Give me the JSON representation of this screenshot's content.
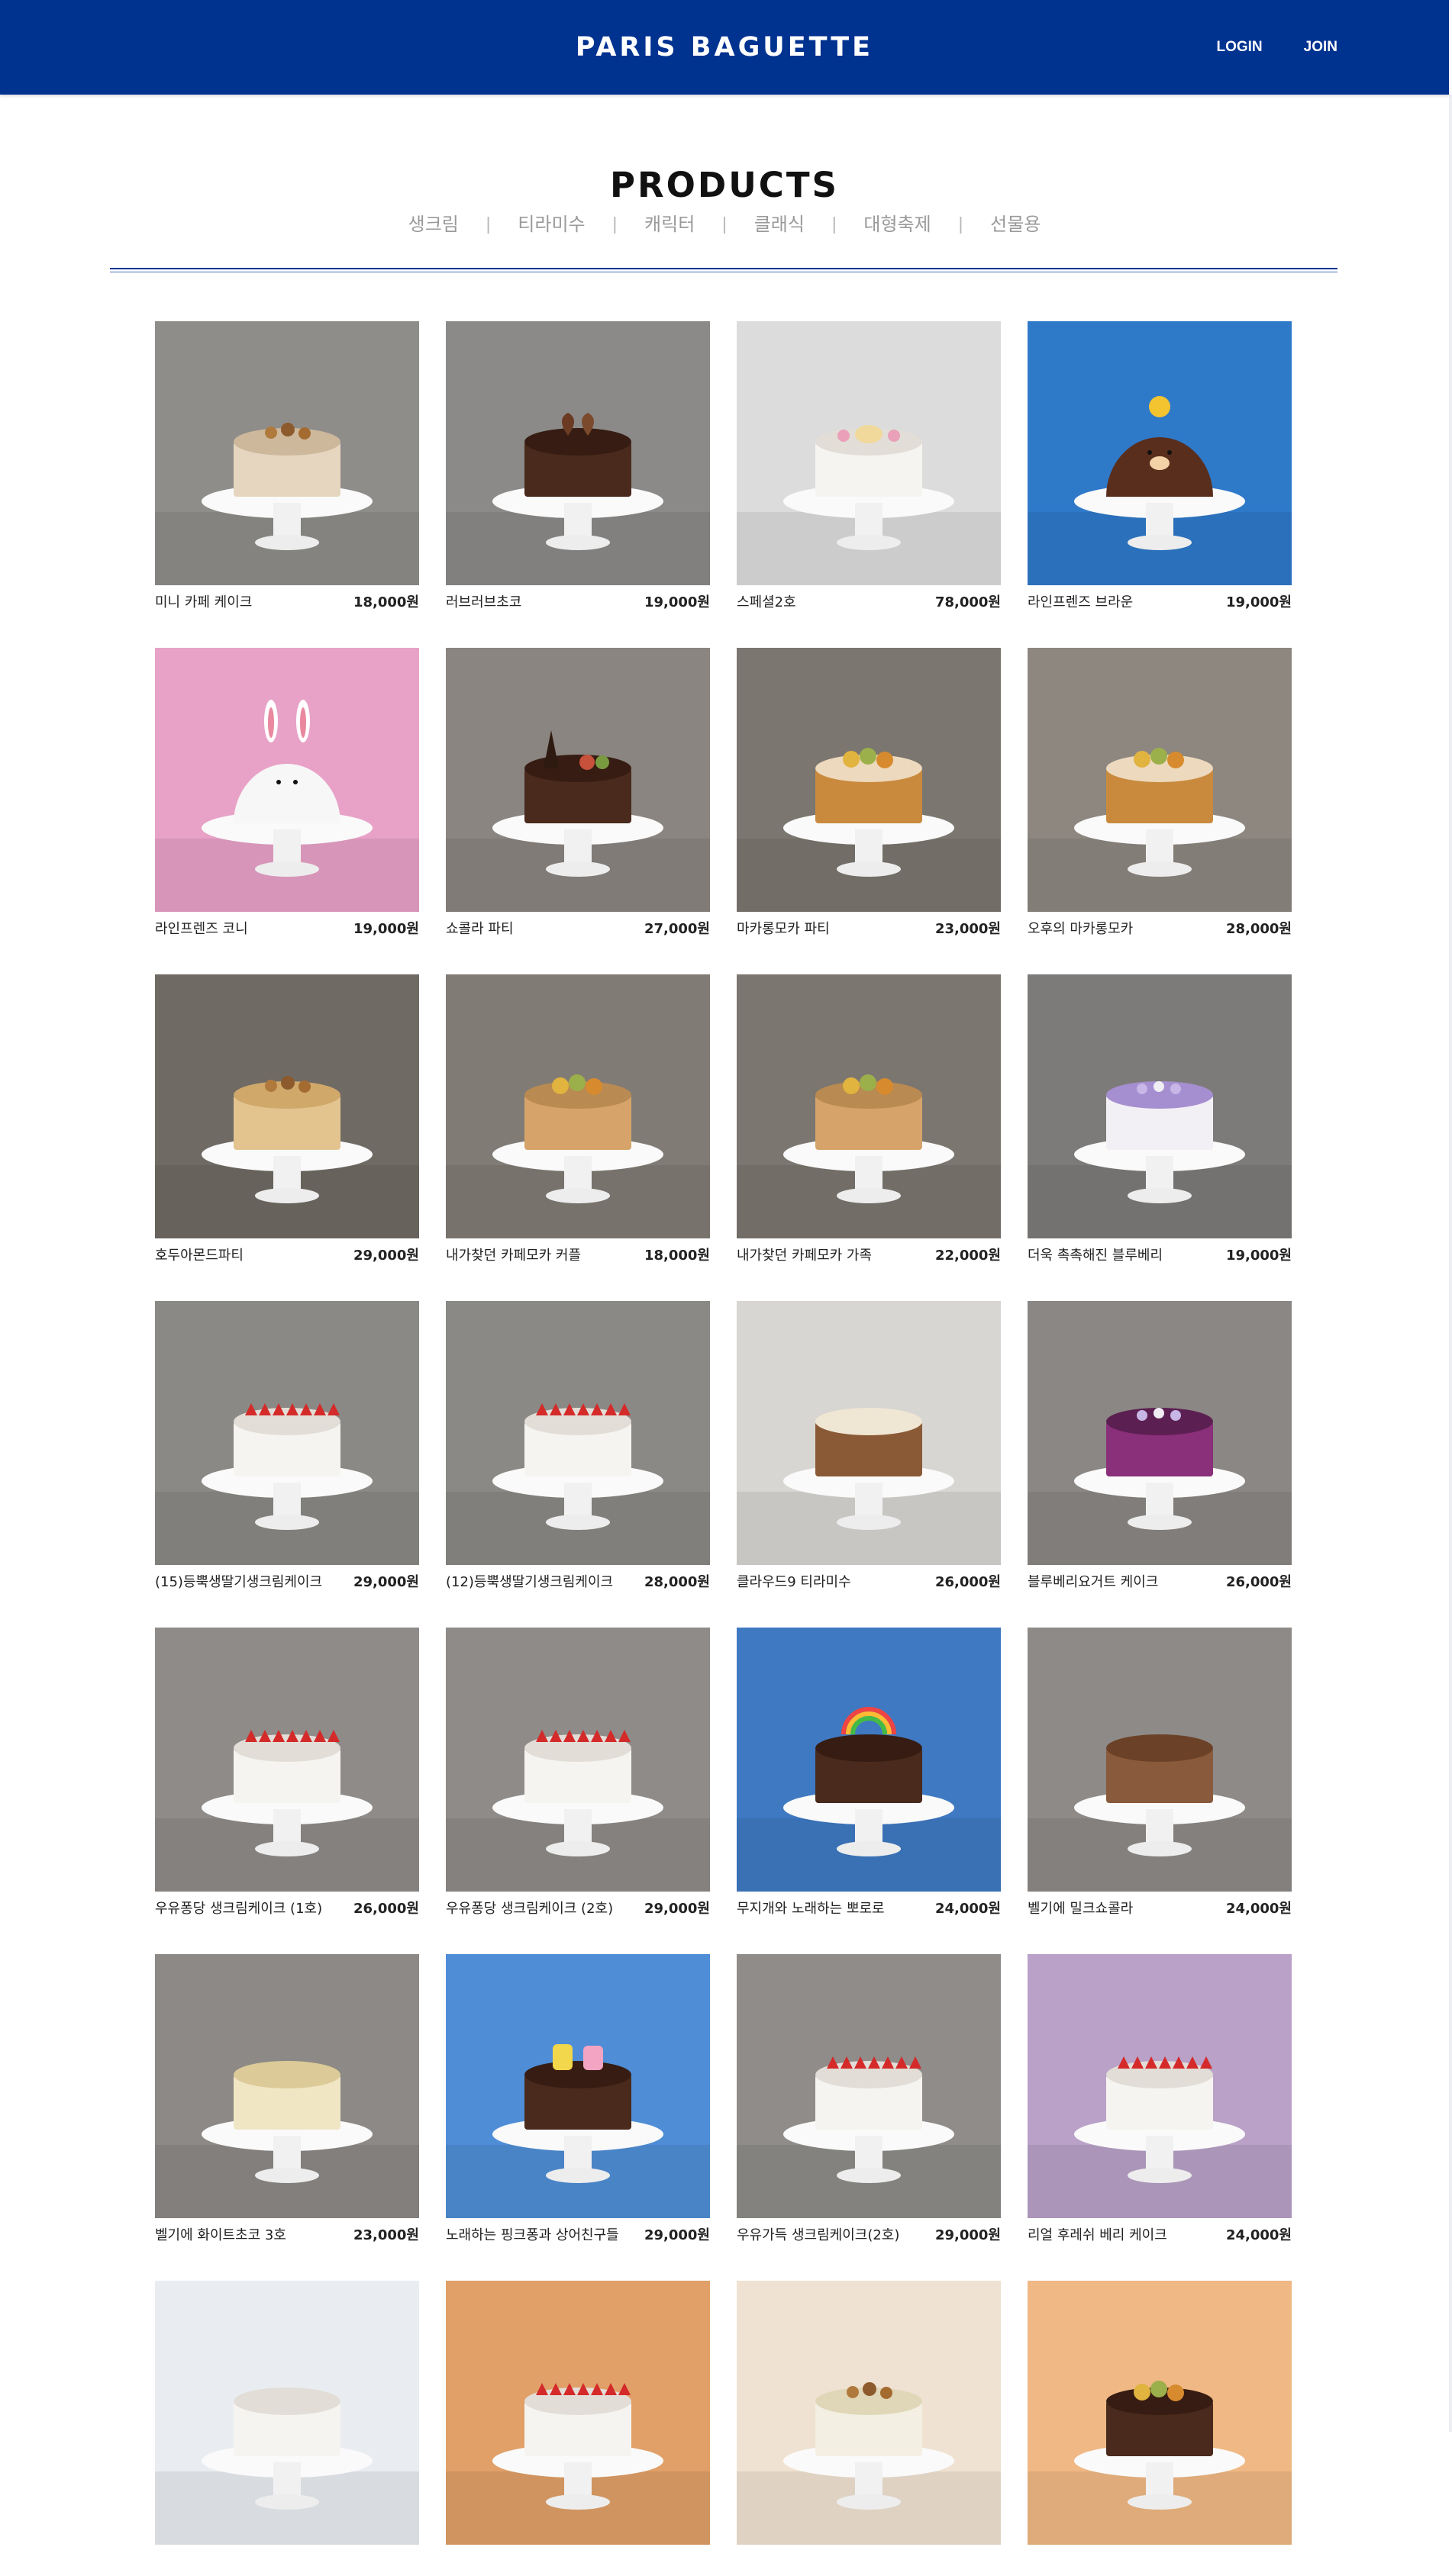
{
  "header": {
    "logo": "PARIS BAGUETTE",
    "login": "LOGIN",
    "join": "JOIN",
    "bg_color": "#003290"
  },
  "page": {
    "title": "PRODUCTS"
  },
  "categories": [
    "생크림",
    "티라미수",
    "캐릭터",
    "클래식",
    "대형축제",
    "선물용"
  ],
  "products": [
    {
      "name": "미니 카페 케이크",
      "price": "18,000원",
      "bg": "#8f8d8a",
      "cake": "latte",
      "decor": "nuts"
    },
    {
      "name": "러브러브초코",
      "price": "19,000원",
      "bg": "#8c8a88",
      "cake": "choco",
      "decor": "hearts"
    },
    {
      "name": "스페셜2호",
      "price": "78,000원",
      "bg": "#dcdcdc",
      "cake": "white",
      "decor": "roses"
    },
    {
      "name": "라인프렌즈 브라운",
      "price": "19,000원",
      "bg": "#2f79c9",
      "cake": "brown-dome",
      "decor": "bear"
    },
    {
      "name": "라인프렌즈 코니",
      "price": "19,000원",
      "bg": "#e8a2c8",
      "cake": "white-dome",
      "decor": "bunny"
    },
    {
      "name": "쇼콜라 파티",
      "price": "27,000원",
      "bg": "#8a8580",
      "cake": "choco",
      "decor": "eiffel"
    },
    {
      "name": "마카롱모카 파티",
      "price": "23,000원",
      "bg": "#7b766f",
      "cake": "caramel",
      "decor": "macaron"
    },
    {
      "name": "오후의 마카롱모카",
      "price": "28,000원",
      "bg": "#8d8780",
      "cake": "caramel",
      "decor": "macaron"
    },
    {
      "name": "호두아몬드파티",
      "price": "29,000원",
      "bg": "#6f6a64",
      "cake": "almond",
      "decor": "swirl"
    },
    {
      "name": "내가찾던 카페모카 커플",
      "price": "18,000원",
      "bg": "#807b75",
      "cake": "sponge",
      "decor": "macaron"
    },
    {
      "name": "내가찾던 카페모카 가족",
      "price": "22,000원",
      "bg": "#7b766f",
      "cake": "sponge",
      "decor": "macaron"
    },
    {
      "name": "더욱 촉촉해진 블루베리",
      "price": "19,000원",
      "bg": "#7d7b79",
      "cake": "blueberry",
      "decor": "cream"
    },
    {
      "name": "(15)등뿍생딸기생크림케이크",
      "price": "29,000원",
      "bg": "#8b8985",
      "cake": "white",
      "decor": "strawberry"
    },
    {
      "name": "(12)등뿍생딸기생크림케이크",
      "price": "28,000원",
      "bg": "#8b8985",
      "cake": "white",
      "decor": "strawberry"
    },
    {
      "name": "클라우드9 티라미수",
      "price": "26,000원",
      "bg": "#d8d6d2",
      "cake": "tiramisu",
      "decor": "cocoa"
    },
    {
      "name": "블루베리요거트 케이크",
      "price": "26,000원",
      "bg": "#8a8784",
      "cake": "berry-yogurt",
      "decor": "berry"
    },
    {
      "name": "우유퐁당 생크림케이크 (1호)",
      "price": "26,000원",
      "bg": "#8e8b88",
      "cake": "white",
      "decor": "strawberry"
    },
    {
      "name": "우유퐁당 생크림케이크 (2호)",
      "price": "29,000원",
      "bg": "#8e8b88",
      "cake": "white",
      "decor": "strawberry"
    },
    {
      "name": "무지개와 노래하는 뽀로로",
      "price": "24,000원",
      "bg": "#3f79c2",
      "cake": "choco",
      "decor": "rainbow"
    },
    {
      "name": "벨기에 밀크쇼콜라",
      "price": "24,000원",
      "bg": "#8d8a87",
      "cake": "choco-flake",
      "decor": "flakes"
    },
    {
      "name": "벨기에 화이트초코 3호",
      "price": "23,000원",
      "bg": "#8c8986",
      "cake": "white-flake",
      "decor": "flakes"
    },
    {
      "name": "노래하는 핑크퐁과 상어친구들",
      "price": "29,000원",
      "bg": "#4f8ed6",
      "cake": "choco",
      "decor": "shark"
    },
    {
      "name": "우유가득 생크림케이크(2호)",
      "price": "29,000원",
      "bg": "#8f8c89",
      "cake": "white",
      "decor": "strawberry"
    },
    {
      "name": "리얼 후레쉬 베리 케이크",
      "price": "24,000원",
      "bg": "#b9a1c8",
      "cake": "white",
      "decor": "strawberry"
    },
    {
      "name": "",
      "price": "",
      "bg": "#e9edf2",
      "cake": "white",
      "decor": "plain"
    },
    {
      "name": "",
      "price": "",
      "bg": "#e0a068",
      "cake": "white",
      "decor": "strawberry"
    },
    {
      "name": "",
      "price": "",
      "bg": "#f0e2d2",
      "cake": "cream",
      "decor": "fruit"
    },
    {
      "name": "",
      "price": "",
      "bg": "#f0b884",
      "cake": "choco",
      "decor": "macaron"
    }
  ]
}
